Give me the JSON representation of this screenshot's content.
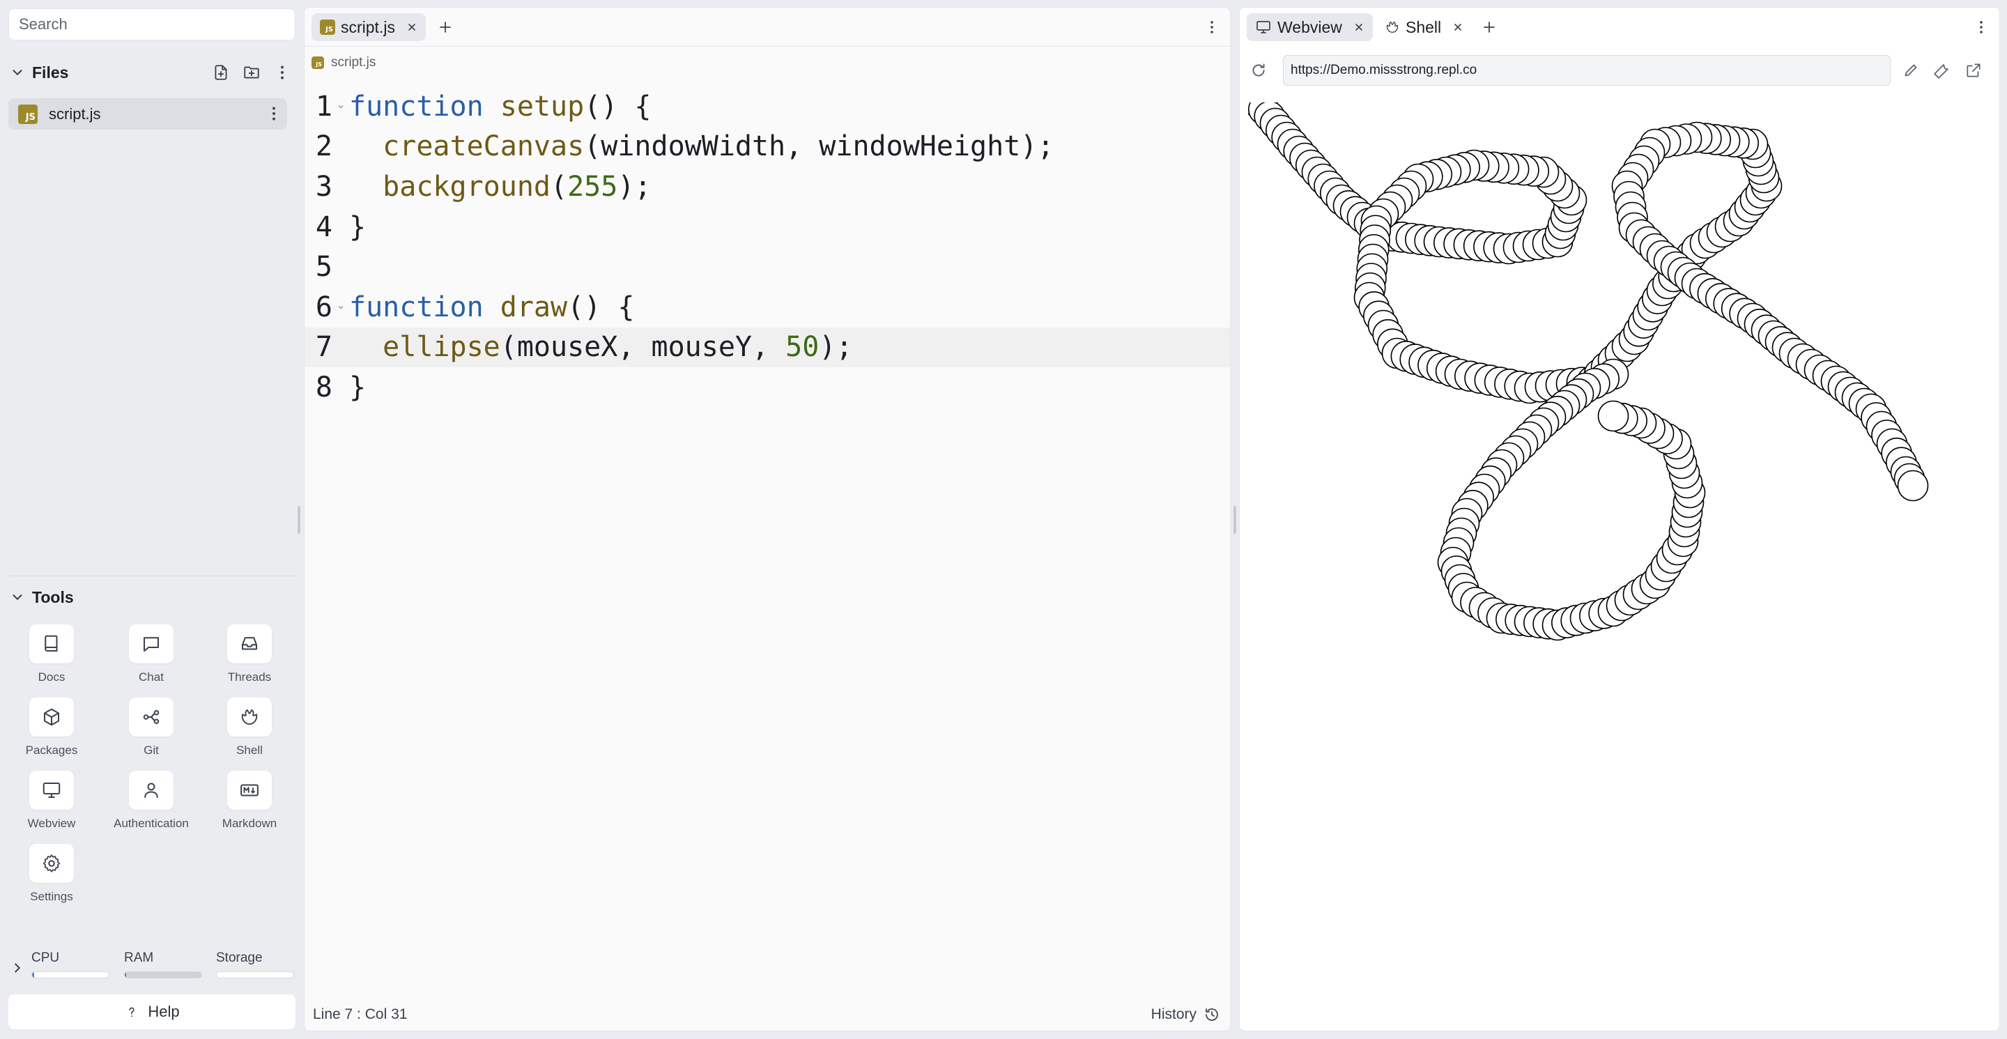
{
  "sidebar": {
    "search_placeholder": "Search",
    "files_title": "Files",
    "files": [
      {
        "name": "script.js",
        "badge": "JS"
      }
    ],
    "tools_title": "Tools",
    "tools": [
      {
        "label": "Docs",
        "icon": "book-icon"
      },
      {
        "label": "Chat",
        "icon": "chat-icon"
      },
      {
        "label": "Threads",
        "icon": "inbox-icon"
      },
      {
        "label": "Packages",
        "icon": "package-icon"
      },
      {
        "label": "Git",
        "icon": "git-icon"
      },
      {
        "label": "Shell",
        "icon": "shell-icon"
      },
      {
        "label": "Webview",
        "icon": "monitor-icon"
      },
      {
        "label": "Authentication",
        "icon": "user-icon"
      },
      {
        "label": "Markdown",
        "icon": "markdown-icon"
      },
      {
        "label": "Settings",
        "icon": "gear-icon"
      }
    ],
    "resources": [
      {
        "label": "CPU",
        "level": 0.03
      },
      {
        "label": "RAM",
        "level": 0.02
      },
      {
        "label": "Storage",
        "level": 0.0
      }
    ],
    "help_label": "Help"
  },
  "editor": {
    "tab_label": "script.js",
    "breadcrumb": "script.js",
    "line_numbers": [
      "1",
      "2",
      "3",
      "4",
      "5",
      "6",
      "7",
      "8"
    ],
    "code": {
      "l1": {
        "kw": "function",
        "fn": "setup",
        "rest": "() {"
      },
      "l2": {
        "fn": "createCanvas",
        "rest": "(windowWidth, windowHeight);"
      },
      "l3": {
        "fn": "background",
        "pre": "(",
        "num": "255",
        "rest": ");"
      },
      "l4": {
        "rest": "}"
      },
      "l6": {
        "kw": "function",
        "fn": "draw",
        "rest": "() {"
      },
      "l7": {
        "fn": "ellipse",
        "pre": "(mouseX, mouseY, ",
        "num": "50",
        "rest": ");"
      },
      "l8": {
        "rest": "}"
      }
    },
    "cursor_status": "Line 7 : Col 31",
    "history_label": "History"
  },
  "webview": {
    "tabs": [
      {
        "label": "Webview",
        "icon": "monitor-icon"
      },
      {
        "label": "Shell",
        "icon": "shell-icon"
      }
    ],
    "url": "https://Demo.missstrong.repl.co",
    "circle_diameter": 50
  },
  "colors": {
    "keyword": "#2a5ea8",
    "function": "#6e5a16",
    "number": "#3c6b17",
    "js_badge": "#9e8a2a",
    "accent": "#4a7fe0"
  }
}
